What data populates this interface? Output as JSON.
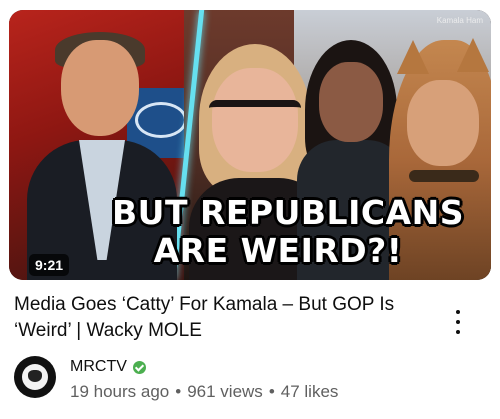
{
  "video": {
    "duration": "9:21",
    "thumbnail_headline": [
      "BUT REPUBLICANS",
      "ARE WEIRD?!"
    ],
    "thumbnail_watermark": "Kamala Ham",
    "title": "Media Goes ‘Catty’ For Kamala – But GOP Is ‘Weird’ | Wacky MOLE",
    "channel": "MRCTV",
    "age": "19 hours ago",
    "views": "961 views",
    "likes": "47 likes",
    "separator": "•"
  },
  "colors": {
    "verified_badge": "#4caf50",
    "meta_text": "#606060",
    "title_text": "#0f0f0f",
    "divider_accent": "#66e0f0"
  },
  "icons": {
    "more_menu": "more-vertical-icon",
    "verified": "verified-check-icon"
  }
}
